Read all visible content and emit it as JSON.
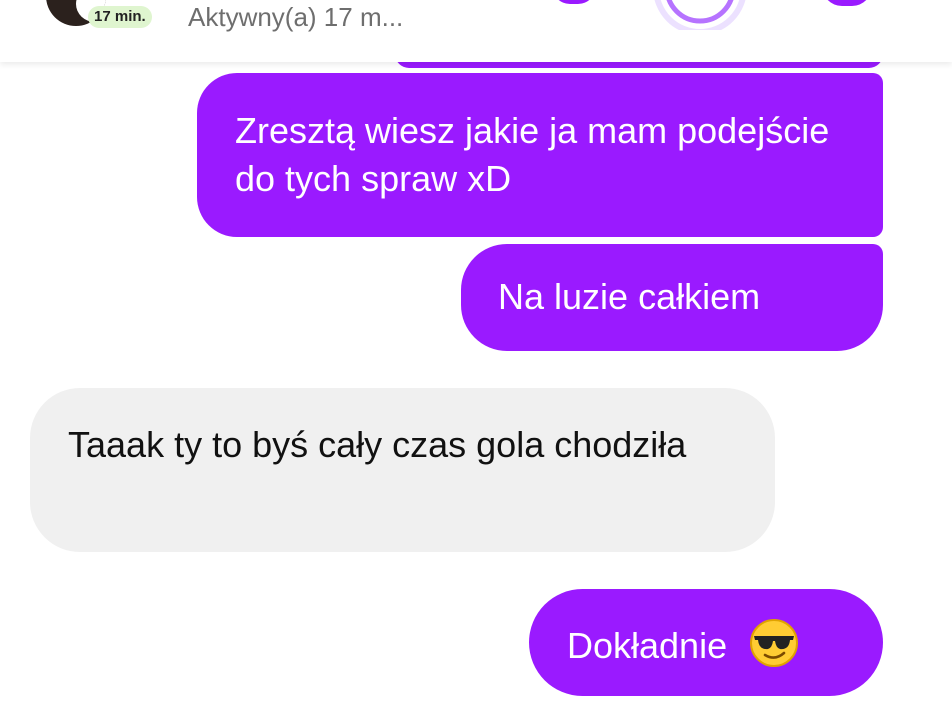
{
  "header": {
    "time_badge": "17 min.",
    "status": "Aktywny(a) 17 m...",
    "accent_color": "#9a1aff"
  },
  "messages": [
    {
      "side": "sent",
      "text": "Zresztą wiesz jakie ja mam podejście do tych spraw xD"
    },
    {
      "side": "sent",
      "text": "Na luzie całkiem"
    },
    {
      "side": "received",
      "text": "Taaak ty to byś cały czas gola chodziła"
    },
    {
      "side": "sent",
      "text": "Dokładnie",
      "emoji": "sunglasses-emoji"
    }
  ]
}
